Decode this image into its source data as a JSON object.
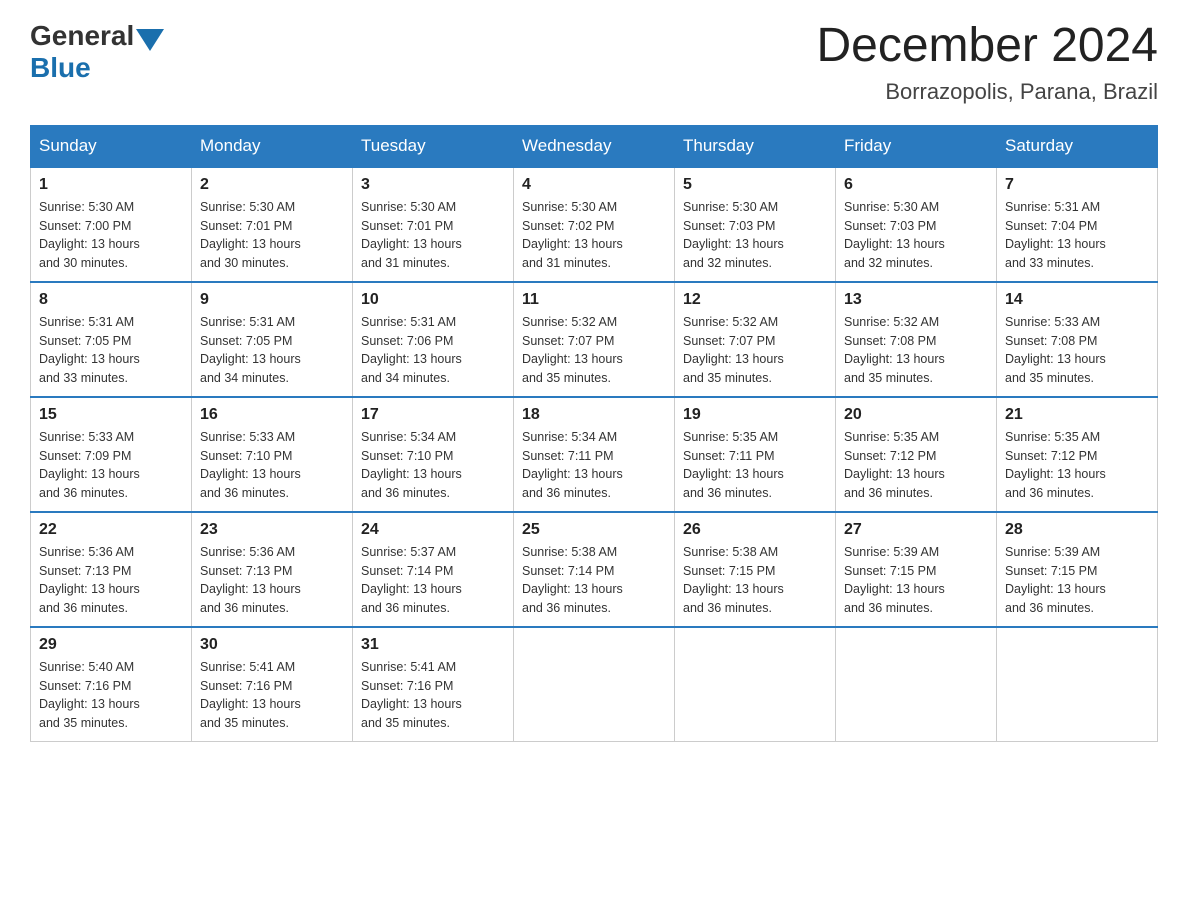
{
  "logo": {
    "general": "General",
    "blue": "Blue"
  },
  "header": {
    "month_year": "December 2024",
    "location": "Borrazopolis, Parana, Brazil"
  },
  "days_of_week": [
    "Sunday",
    "Monday",
    "Tuesday",
    "Wednesday",
    "Thursday",
    "Friday",
    "Saturday"
  ],
  "weeks": [
    [
      {
        "day": "1",
        "sunrise": "5:30 AM",
        "sunset": "7:00 PM",
        "daylight": "13 hours and 30 minutes."
      },
      {
        "day": "2",
        "sunrise": "5:30 AM",
        "sunset": "7:01 PM",
        "daylight": "13 hours and 30 minutes."
      },
      {
        "day": "3",
        "sunrise": "5:30 AM",
        "sunset": "7:01 PM",
        "daylight": "13 hours and 31 minutes."
      },
      {
        "day": "4",
        "sunrise": "5:30 AM",
        "sunset": "7:02 PM",
        "daylight": "13 hours and 31 minutes."
      },
      {
        "day": "5",
        "sunrise": "5:30 AM",
        "sunset": "7:03 PM",
        "daylight": "13 hours and 32 minutes."
      },
      {
        "day": "6",
        "sunrise": "5:30 AM",
        "sunset": "7:03 PM",
        "daylight": "13 hours and 32 minutes."
      },
      {
        "day": "7",
        "sunrise": "5:31 AM",
        "sunset": "7:04 PM",
        "daylight": "13 hours and 33 minutes."
      }
    ],
    [
      {
        "day": "8",
        "sunrise": "5:31 AM",
        "sunset": "7:05 PM",
        "daylight": "13 hours and 33 minutes."
      },
      {
        "day": "9",
        "sunrise": "5:31 AM",
        "sunset": "7:05 PM",
        "daylight": "13 hours and 34 minutes."
      },
      {
        "day": "10",
        "sunrise": "5:31 AM",
        "sunset": "7:06 PM",
        "daylight": "13 hours and 34 minutes."
      },
      {
        "day": "11",
        "sunrise": "5:32 AM",
        "sunset": "7:07 PM",
        "daylight": "13 hours and 35 minutes."
      },
      {
        "day": "12",
        "sunrise": "5:32 AM",
        "sunset": "7:07 PM",
        "daylight": "13 hours and 35 minutes."
      },
      {
        "day": "13",
        "sunrise": "5:32 AM",
        "sunset": "7:08 PM",
        "daylight": "13 hours and 35 minutes."
      },
      {
        "day": "14",
        "sunrise": "5:33 AM",
        "sunset": "7:08 PM",
        "daylight": "13 hours and 35 minutes."
      }
    ],
    [
      {
        "day": "15",
        "sunrise": "5:33 AM",
        "sunset": "7:09 PM",
        "daylight": "13 hours and 36 minutes."
      },
      {
        "day": "16",
        "sunrise": "5:33 AM",
        "sunset": "7:10 PM",
        "daylight": "13 hours and 36 minutes."
      },
      {
        "day": "17",
        "sunrise": "5:34 AM",
        "sunset": "7:10 PM",
        "daylight": "13 hours and 36 minutes."
      },
      {
        "day": "18",
        "sunrise": "5:34 AM",
        "sunset": "7:11 PM",
        "daylight": "13 hours and 36 minutes."
      },
      {
        "day": "19",
        "sunrise": "5:35 AM",
        "sunset": "7:11 PM",
        "daylight": "13 hours and 36 minutes."
      },
      {
        "day": "20",
        "sunrise": "5:35 AM",
        "sunset": "7:12 PM",
        "daylight": "13 hours and 36 minutes."
      },
      {
        "day": "21",
        "sunrise": "5:35 AM",
        "sunset": "7:12 PM",
        "daylight": "13 hours and 36 minutes."
      }
    ],
    [
      {
        "day": "22",
        "sunrise": "5:36 AM",
        "sunset": "7:13 PM",
        "daylight": "13 hours and 36 minutes."
      },
      {
        "day": "23",
        "sunrise": "5:36 AM",
        "sunset": "7:13 PM",
        "daylight": "13 hours and 36 minutes."
      },
      {
        "day": "24",
        "sunrise": "5:37 AM",
        "sunset": "7:14 PM",
        "daylight": "13 hours and 36 minutes."
      },
      {
        "day": "25",
        "sunrise": "5:38 AM",
        "sunset": "7:14 PM",
        "daylight": "13 hours and 36 minutes."
      },
      {
        "day": "26",
        "sunrise": "5:38 AM",
        "sunset": "7:15 PM",
        "daylight": "13 hours and 36 minutes."
      },
      {
        "day": "27",
        "sunrise": "5:39 AM",
        "sunset": "7:15 PM",
        "daylight": "13 hours and 36 minutes."
      },
      {
        "day": "28",
        "sunrise": "5:39 AM",
        "sunset": "7:15 PM",
        "daylight": "13 hours and 36 minutes."
      }
    ],
    [
      {
        "day": "29",
        "sunrise": "5:40 AM",
        "sunset": "7:16 PM",
        "daylight": "13 hours and 35 minutes."
      },
      {
        "day": "30",
        "sunrise": "5:41 AM",
        "sunset": "7:16 PM",
        "daylight": "13 hours and 35 minutes."
      },
      {
        "day": "31",
        "sunrise": "5:41 AM",
        "sunset": "7:16 PM",
        "daylight": "13 hours and 35 minutes."
      },
      null,
      null,
      null,
      null
    ]
  ],
  "labels": {
    "sunrise": "Sunrise:",
    "sunset": "Sunset:",
    "daylight": "Daylight:"
  }
}
